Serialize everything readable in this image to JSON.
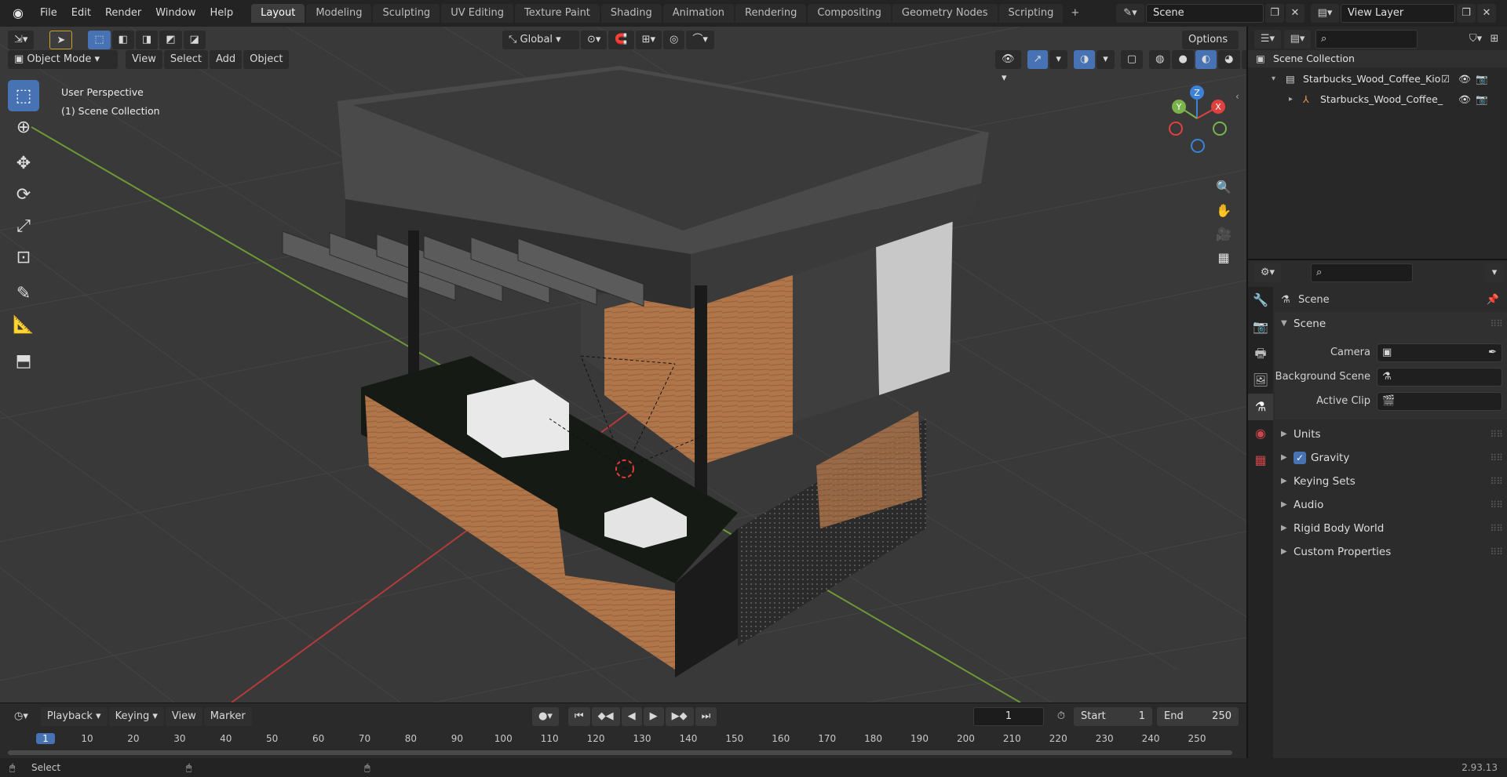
{
  "topbar": {
    "menus": [
      "File",
      "Edit",
      "Render",
      "Window",
      "Help"
    ],
    "workspaces": [
      "Layout",
      "Modeling",
      "Sculpting",
      "UV Editing",
      "Texture Paint",
      "Shading",
      "Animation",
      "Rendering",
      "Compositing",
      "Geometry Nodes",
      "Scripting"
    ],
    "add_tab": "+",
    "scene_name": "Scene",
    "view_layer": "View Layer"
  },
  "toolheader": {
    "transform_orientation": "Global",
    "options_label": "Options"
  },
  "header": {
    "mode": "Object Mode",
    "menus": [
      "View",
      "Select",
      "Add",
      "Object"
    ]
  },
  "viewport": {
    "overlay_line1": "User Perspective",
    "overlay_line2": "(1) Scene Collection",
    "gizmo_axes": {
      "x": "X",
      "y": "Y",
      "z": "Z"
    }
  },
  "outliner": {
    "root": "Scene Collection",
    "collection": "Starbucks_Wood_Coffee_Kios",
    "object": "Starbucks_Wood_Coffee_"
  },
  "properties": {
    "context": "Scene",
    "panel_title": "Scene",
    "camera_label": "Camera",
    "background_scene_label": "Background Scene",
    "active_clip_label": "Active Clip",
    "subpanels": [
      "Units",
      "Gravity",
      "Keying Sets",
      "Audio",
      "Rigid Body World",
      "Custom Properties"
    ],
    "gravity_enabled": true
  },
  "timeline": {
    "menus": [
      "Playback",
      "Keying",
      "View",
      "Marker"
    ],
    "current_frame": "1",
    "start_label": "Start",
    "start_value": "1",
    "end_label": "End",
    "end_value": "250",
    "ruler": [
      "1",
      "10",
      "20",
      "30",
      "40",
      "50",
      "60",
      "70",
      "80",
      "90",
      "100",
      "110",
      "120",
      "130",
      "140",
      "150",
      "160",
      "170",
      "180",
      "190",
      "200",
      "210",
      "220",
      "230",
      "240",
      "250"
    ]
  },
  "statusbar": {
    "select_label": "Select",
    "version": "2.93.13"
  },
  "colors": {
    "accent": "#4772b3",
    "axis_x": "#e0413f",
    "axis_y": "#7ab34a",
    "axis_z": "#3b82d8",
    "wood": "#b0764a"
  }
}
